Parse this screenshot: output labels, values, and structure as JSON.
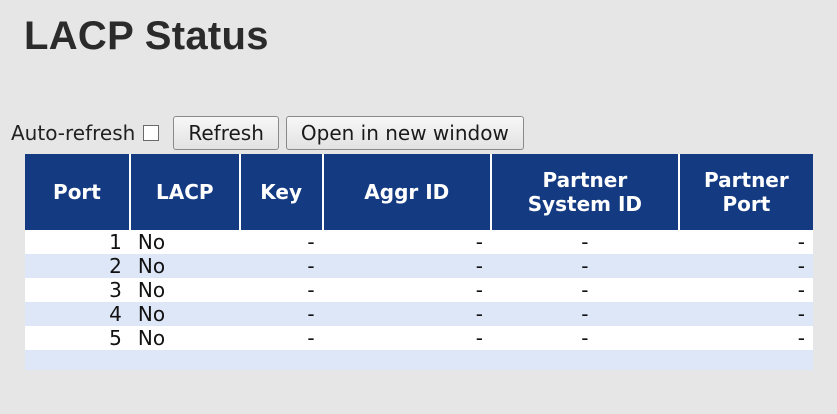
{
  "page": {
    "title": "LACP Status"
  },
  "toolbar": {
    "auto_refresh_label": "Auto-refresh",
    "refresh_label": "Refresh",
    "open_window_label": "Open in new window"
  },
  "table": {
    "headers": {
      "port": "Port",
      "lacp": "LACP",
      "key": "Key",
      "aggr_id": "Aggr ID",
      "partner_system_id_line1": "Partner",
      "partner_system_id_line2": "System ID",
      "partner_port_line1": "Partner",
      "partner_port_line2": "Port"
    },
    "rows": [
      {
        "port": "1",
        "lacp": "No",
        "key": "-",
        "aggr_id": "-",
        "partner_system_id": "-",
        "partner_port": "-"
      },
      {
        "port": "2",
        "lacp": "No",
        "key": "-",
        "aggr_id": "-",
        "partner_system_id": "-",
        "partner_port": "-"
      },
      {
        "port": "3",
        "lacp": "No",
        "key": "-",
        "aggr_id": "-",
        "partner_system_id": "-",
        "partner_port": "-"
      },
      {
        "port": "4",
        "lacp": "No",
        "key": "-",
        "aggr_id": "-",
        "partner_system_id": "-",
        "partner_port": "-"
      },
      {
        "port": "5",
        "lacp": "No",
        "key": "-",
        "aggr_id": "-",
        "partner_system_id": "-",
        "partner_port": "-"
      }
    ]
  },
  "colors": {
    "header_bg": "#143a81",
    "row_alt_bg": "#dde7f8",
    "page_bg": "#e6e6e6"
  }
}
